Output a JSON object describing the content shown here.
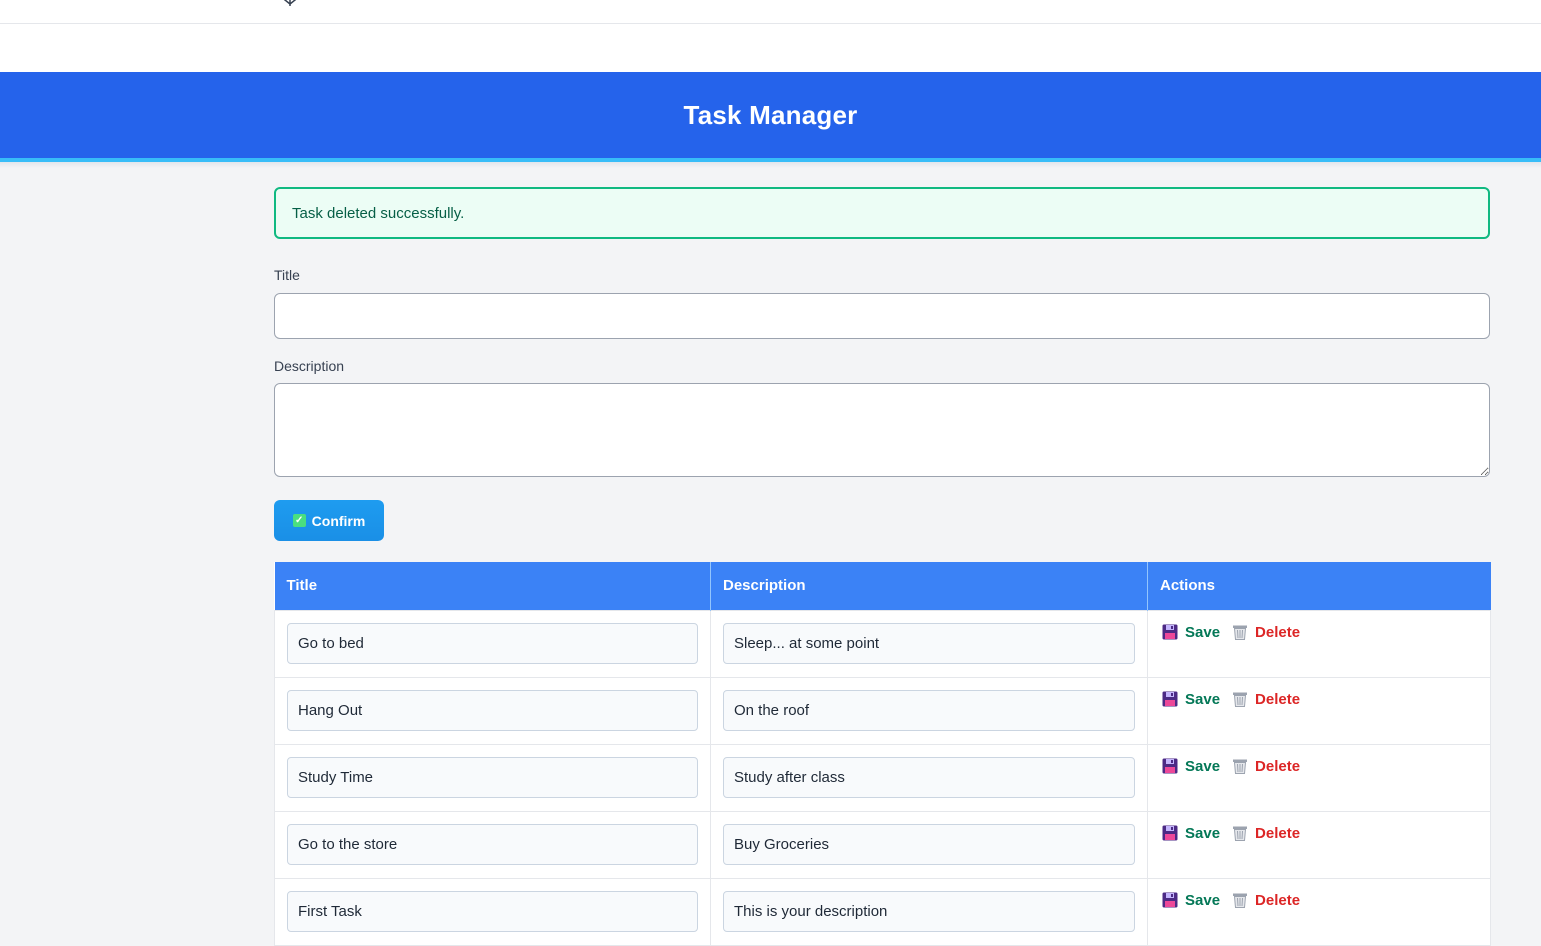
{
  "header": {
    "title": "Task Manager"
  },
  "alert": {
    "message": "Task deleted successfully."
  },
  "form": {
    "title_label": "Title",
    "title_value": "",
    "description_label": "Description",
    "description_value": "",
    "confirm_label": "Confirm"
  },
  "table": {
    "columns": [
      "Title",
      "Description",
      "Actions"
    ],
    "save_label": "Save",
    "delete_label": "Delete",
    "rows": [
      {
        "title": "Go to bed",
        "description": "Sleep... at some point"
      },
      {
        "title": "Hang Out",
        "description": "On the roof"
      },
      {
        "title": "Study Time",
        "description": "Study after class"
      },
      {
        "title": "Go to the store",
        "description": "Buy Groceries"
      },
      {
        "title": "First Task",
        "description": "This is your description"
      }
    ]
  },
  "colors": {
    "header_bg": "#2563eb",
    "alert_border": "#10b981",
    "table_header_bg": "#3b82f6",
    "save": "#047857",
    "delete": "#dc2626"
  }
}
